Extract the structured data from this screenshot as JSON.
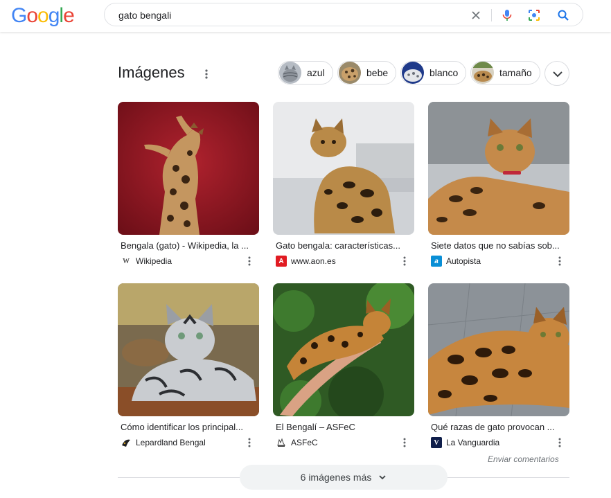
{
  "logo": {
    "letters": [
      "G",
      "o",
      "o",
      "g",
      "l",
      "e"
    ],
    "colors": [
      "#4285F4",
      "#EA4335",
      "#FBBC05",
      "#4285F4",
      "#34A853",
      "#EA4335"
    ]
  },
  "search": {
    "query": "gato bengali"
  },
  "section": {
    "title": "Imágenes"
  },
  "chips": [
    {
      "label": "azul"
    },
    {
      "label": "bebe"
    },
    {
      "label": "blanco"
    },
    {
      "label": "tamaño"
    }
  ],
  "results": [
    {
      "caption": "Bengala (gato) - Wikipedia, la ...",
      "site": "Wikipedia",
      "favicon": "W"
    },
    {
      "caption": "Gato bengala: características...",
      "site": "www.aon.es",
      "favicon": "A"
    },
    {
      "caption": "Siete datos que no sabías sob...",
      "site": "Autopista",
      "favicon": "a"
    },
    {
      "caption": "Cómo identificar los principal...",
      "site": "Lepardland Bengal",
      "favicon": ""
    },
    {
      "caption": "El Bengalí – ASFeC",
      "site": "ASFeC",
      "favicon": ""
    },
    {
      "caption": "Qué razas de gato provocan ...",
      "site": "La Vanguardia",
      "favicon": "V"
    }
  ],
  "feedback": "Enviar comentarios",
  "more_images": "6 imágenes más",
  "colors": {
    "accent": "#1a73e8",
    "mic": "#4285F4",
    "border": "#dadce0"
  }
}
